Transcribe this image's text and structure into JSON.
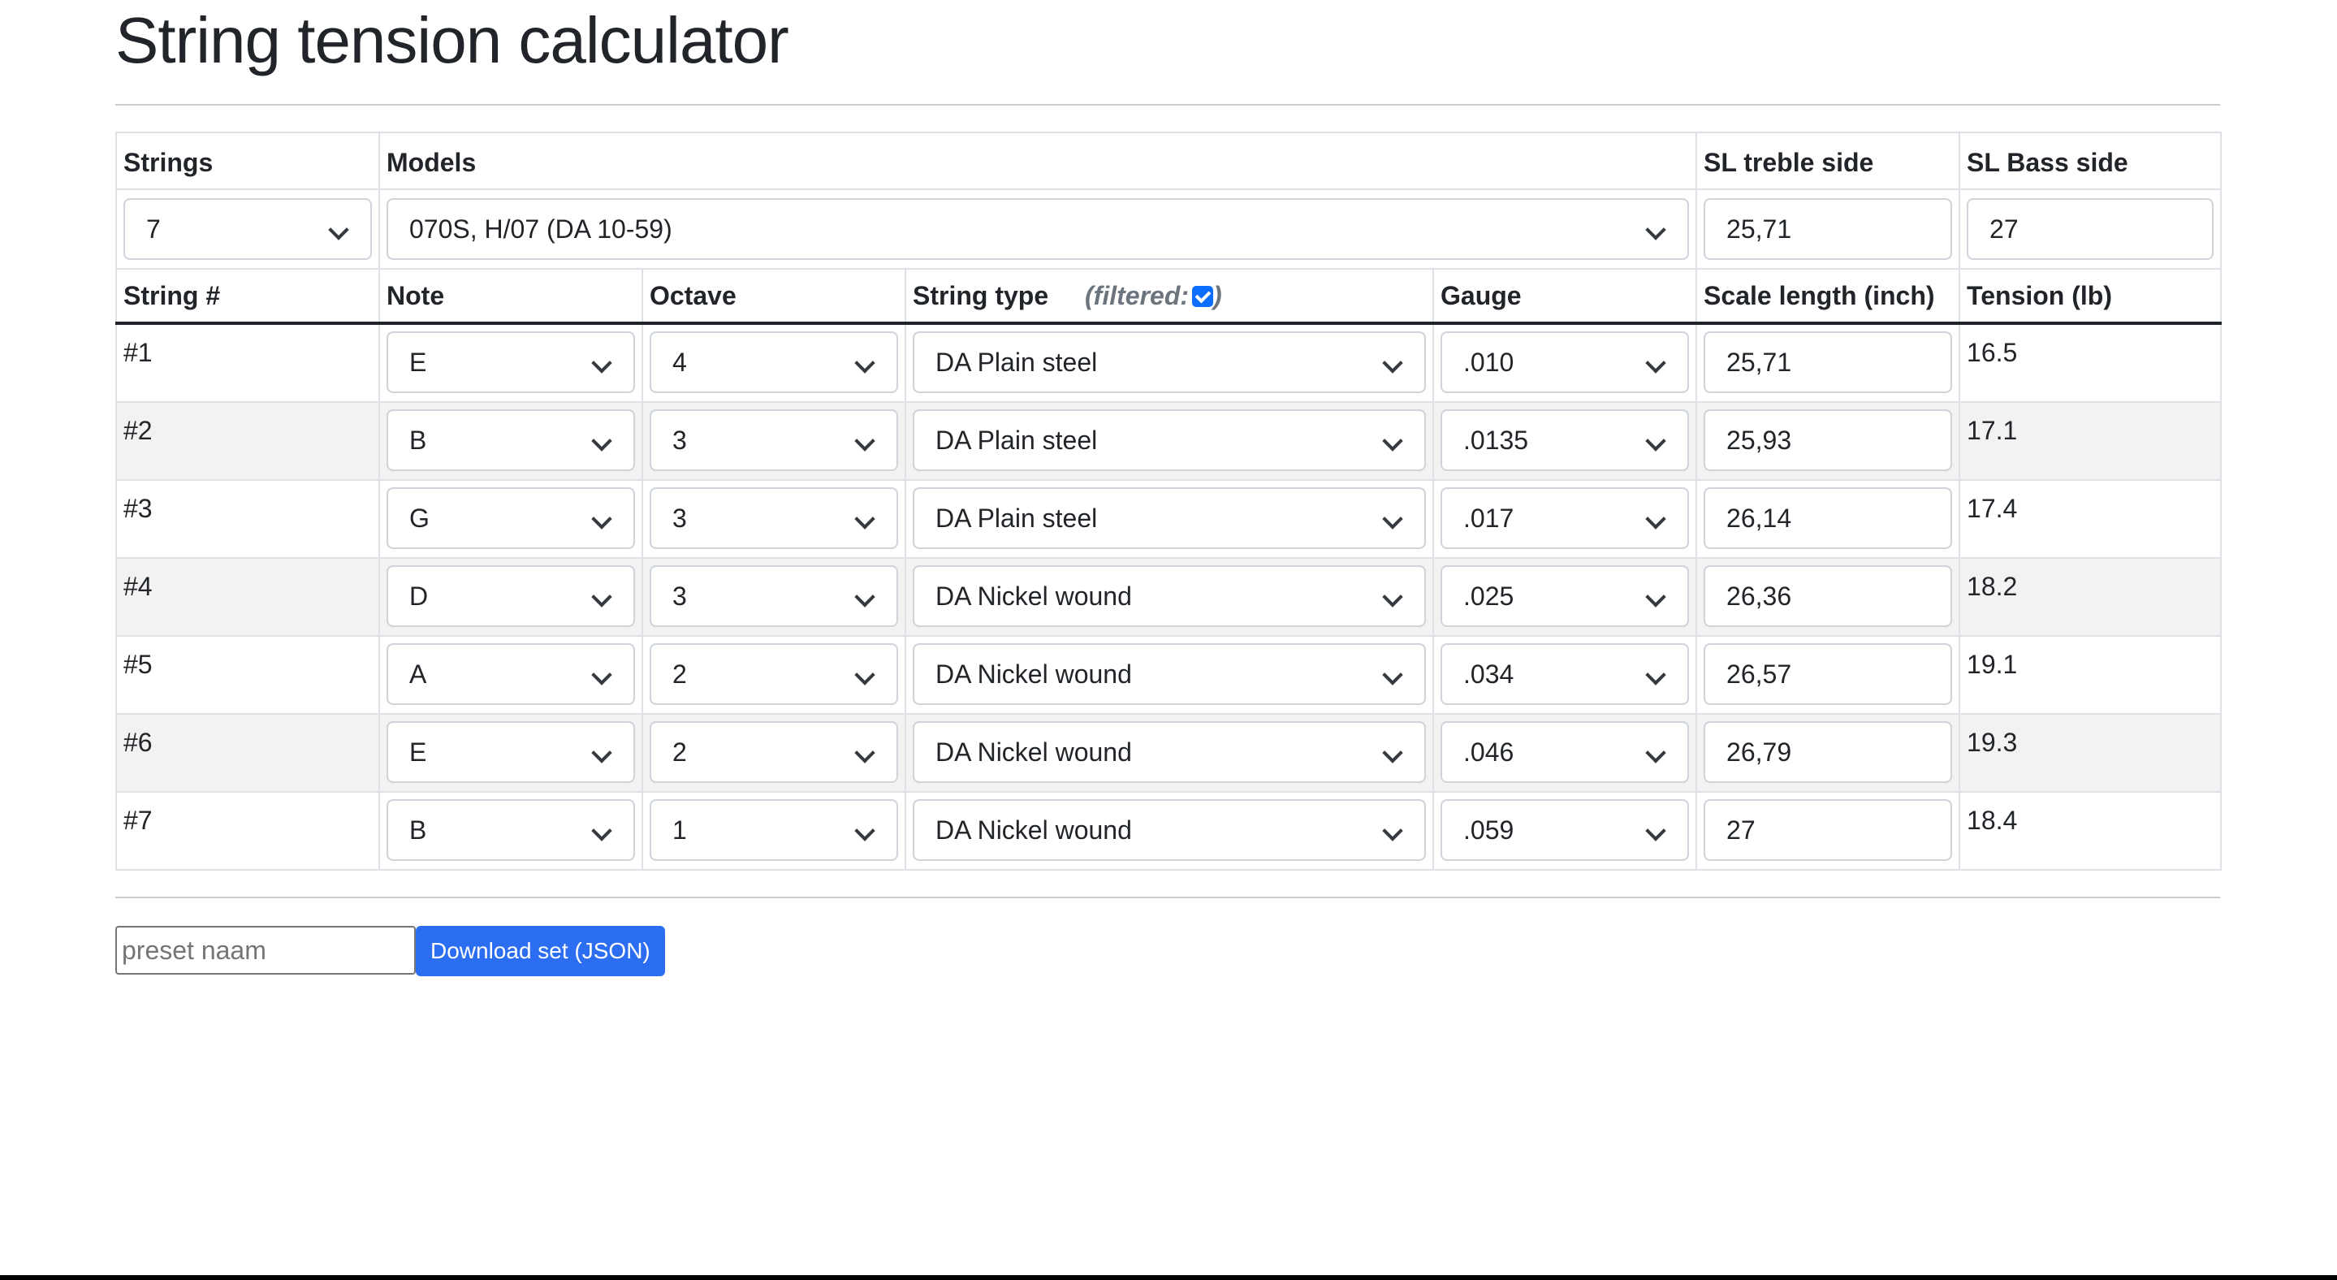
{
  "title": "String tension calculator",
  "table": {
    "top_headers": {
      "strings": "Strings",
      "models": "Models",
      "sl_treble": "SL treble side",
      "sl_bass": "SL Bass side"
    },
    "strings_value": "7",
    "model_value": "070S, H/07 (DA 10-59)",
    "sl_treble_value": "25,71",
    "sl_bass_value": "27",
    "columns": {
      "string_num": "String #",
      "note": "Note",
      "octave": "Octave",
      "string_type": "String type",
      "filtered_label": "(filtered:",
      "filtered_close": ")",
      "filtered_checked": true,
      "gauge": "Gauge",
      "scale_length": "Scale length (inch)",
      "tension": "Tension (lb)"
    },
    "rows": [
      {
        "num": "#1",
        "note": "E",
        "octave": "4",
        "type": "DA Plain steel",
        "gauge": ".010",
        "scale": "25,71",
        "tension": "16.5"
      },
      {
        "num": "#2",
        "note": "B",
        "octave": "3",
        "type": "DA Plain steel",
        "gauge": ".0135",
        "scale": "25,93",
        "tension": "17.1"
      },
      {
        "num": "#3",
        "note": "G",
        "octave": "3",
        "type": "DA Plain steel",
        "gauge": ".017",
        "scale": "26,14",
        "tension": "17.4"
      },
      {
        "num": "#4",
        "note": "D",
        "octave": "3",
        "type": "DA Nickel wound",
        "gauge": ".025",
        "scale": "26,36",
        "tension": "18.2"
      },
      {
        "num": "#5",
        "note": "A",
        "octave": "2",
        "type": "DA Nickel wound",
        "gauge": ".034",
        "scale": "26,57",
        "tension": "19.1"
      },
      {
        "num": "#6",
        "note": "E",
        "octave": "2",
        "type": "DA Nickel wound",
        "gauge": ".046",
        "scale": "26,79",
        "tension": "19.3"
      },
      {
        "num": "#7",
        "note": "B",
        "octave": "1",
        "type": "DA Nickel wound",
        "gauge": ".059",
        "scale": "27",
        "tension": "18.4"
      }
    ]
  },
  "preset": {
    "placeholder": "preset naam",
    "download_label": "Download set (JSON)"
  },
  "colors": {
    "accent": "#2c6ef2",
    "stripe": "#f2f2f2",
    "border": "#dee2e6"
  }
}
